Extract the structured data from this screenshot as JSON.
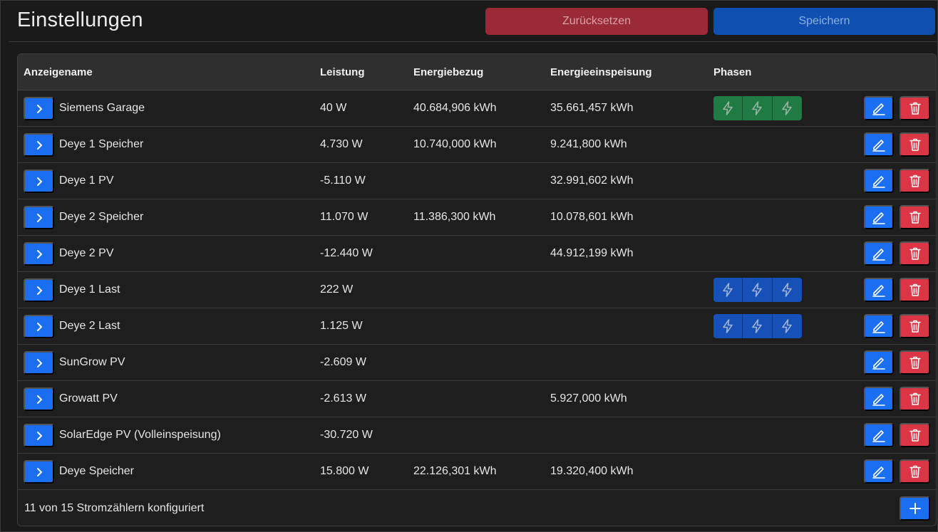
{
  "header": {
    "title": "Einstellungen",
    "reset_label": "Zurücksetzen",
    "save_label": "Speichern"
  },
  "colors": {
    "primary": "#1a6ef2",
    "danger": "#dc3545",
    "phase_green": "#1f7a44",
    "phase_blue": "#1651b8"
  },
  "table": {
    "columns": [
      "Anzeigename",
      "Leistung",
      "Energiebezug",
      "Energieeinspeisung",
      "Phasen"
    ],
    "rows": [
      {
        "name": "Siemens Garage",
        "power": "40 W",
        "import": "40.684,906 kWh",
        "export": "35.661,457 kWh",
        "phases": "green"
      },
      {
        "name": "Deye 1 Speicher",
        "power": "4.730 W",
        "import": "10.740,000 kWh",
        "export": "9.241,800 kWh",
        "phases": ""
      },
      {
        "name": "Deye 1 PV",
        "power": "-5.110 W",
        "import": "",
        "export": "32.991,602 kWh",
        "phases": ""
      },
      {
        "name": "Deye 2 Speicher",
        "power": "11.070 W",
        "import": "11.386,300 kWh",
        "export": "10.078,601 kWh",
        "phases": ""
      },
      {
        "name": "Deye 2 PV",
        "power": "-12.440 W",
        "import": "",
        "export": "44.912,199 kWh",
        "phases": ""
      },
      {
        "name": "Deye 1 Last",
        "power": "222 W",
        "import": "",
        "export": "",
        "phases": "blue"
      },
      {
        "name": "Deye 2 Last",
        "power": "1.125 W",
        "import": "",
        "export": "",
        "phases": "blue"
      },
      {
        "name": "SunGrow PV",
        "power": "-2.609 W",
        "import": "",
        "export": "",
        "phases": ""
      },
      {
        "name": "Growatt PV",
        "power": "-2.613 W",
        "import": "",
        "export": "5.927,000 kWh",
        "phases": ""
      },
      {
        "name": "SolarEdge PV (Volleinspeisung)",
        "power": "-30.720 W",
        "import": "",
        "export": "",
        "phases": ""
      },
      {
        "name": "Deye Speicher",
        "power": "15.800 W",
        "import": "22.126,301 kWh",
        "export": "19.320,400 kWh",
        "phases": ""
      }
    ]
  },
  "icons": {
    "expand": "chevron-right-icon",
    "phase": "lightning-icon",
    "edit": "pencil-icon",
    "delete": "trash-icon",
    "add": "plus-icon"
  },
  "footer": {
    "summary": "11 von 15 Stromzählern konfiguriert"
  }
}
